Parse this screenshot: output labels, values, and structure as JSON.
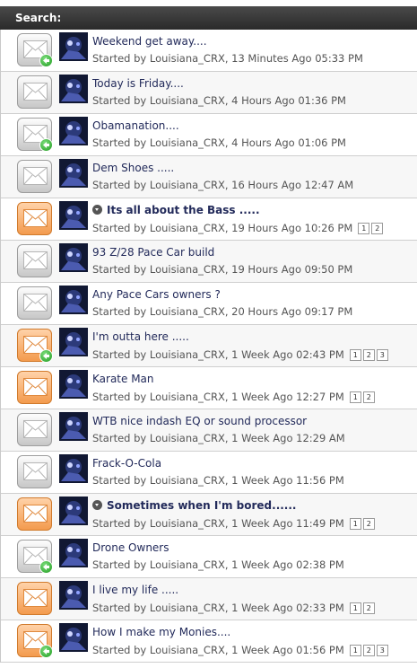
{
  "header": {
    "title": "Search:"
  },
  "threads": [
    {
      "title": "Weekend get away....",
      "meta": "Started by Louisiana_CRX, 13 Minutes Ago 05:33 PM",
      "icon": "gray",
      "new": true,
      "bold": false,
      "sticky": false,
      "pages": []
    },
    {
      "title": "Today is Friday....",
      "meta": "Started by Louisiana_CRX, 4 Hours Ago 01:36 PM",
      "icon": "gray",
      "new": false,
      "bold": false,
      "sticky": false,
      "pages": []
    },
    {
      "title": "Obamanation....",
      "meta": "Started by Louisiana_CRX, 4 Hours Ago 01:06 PM",
      "icon": "gray",
      "new": true,
      "bold": false,
      "sticky": false,
      "pages": []
    },
    {
      "title": "Dem Shoes .....",
      "meta": "Started by Louisiana_CRX, 16 Hours Ago 12:47 AM",
      "icon": "gray",
      "new": false,
      "bold": false,
      "sticky": false,
      "pages": []
    },
    {
      "title": "Its all about the Bass .....",
      "meta": "Started by Louisiana_CRX, 19 Hours Ago 10:26 PM",
      "icon": "orange",
      "new": false,
      "bold": true,
      "sticky": true,
      "pages": [
        "1",
        "2"
      ]
    },
    {
      "title": "93 Z/28 Pace Car build",
      "meta": "Started by Louisiana_CRX, 19 Hours Ago 09:50 PM",
      "icon": "gray",
      "new": false,
      "bold": false,
      "sticky": false,
      "pages": []
    },
    {
      "title": "Any Pace Cars owners ?",
      "meta": "Started by Louisiana_CRX, 20 Hours Ago 09:17 PM",
      "icon": "gray",
      "new": false,
      "bold": false,
      "sticky": false,
      "pages": []
    },
    {
      "title": "I'm outta here .....",
      "meta": "Started by Louisiana_CRX, 1 Week Ago 02:43 PM",
      "icon": "orange",
      "new": true,
      "bold": false,
      "sticky": false,
      "pages": [
        "1",
        "2",
        "3"
      ]
    },
    {
      "title": "Karate Man",
      "meta": "Started by Louisiana_CRX, 1 Week Ago 12:27 PM",
      "icon": "orange",
      "new": false,
      "bold": false,
      "sticky": false,
      "pages": [
        "1",
        "2"
      ]
    },
    {
      "title": "WTB nice indash EQ or sound processor",
      "meta": "Started by Louisiana_CRX, 1 Week Ago 12:29 AM",
      "icon": "gray",
      "new": false,
      "bold": false,
      "sticky": false,
      "pages": []
    },
    {
      "title": "Frack-O-Cola",
      "meta": "Started by Louisiana_CRX, 1 Week Ago 11:56 PM",
      "icon": "gray",
      "new": false,
      "bold": false,
      "sticky": false,
      "pages": []
    },
    {
      "title": "Sometimes when I'm bored......",
      "meta": "Started by Louisiana_CRX, 1 Week Ago 11:49 PM",
      "icon": "orange",
      "new": false,
      "bold": true,
      "sticky": true,
      "pages": [
        "1",
        "2"
      ]
    },
    {
      "title": "Drone Owners",
      "meta": "Started by Louisiana_CRX, 1 Week Ago 02:38 PM",
      "icon": "gray",
      "new": true,
      "bold": false,
      "sticky": false,
      "pages": []
    },
    {
      "title": "I live my life .....",
      "meta": "Started by Louisiana_CRX, 1 Week Ago 02:33 PM",
      "icon": "orange",
      "new": false,
      "bold": false,
      "sticky": false,
      "pages": [
        "1",
        "2"
      ]
    },
    {
      "title": "How I make my Monies....",
      "meta": "Started by Louisiana_CRX, 1 Week Ago 01:56 PM",
      "icon": "orange",
      "new": true,
      "bold": false,
      "sticky": false,
      "pages": [
        "1",
        "2",
        "3"
      ]
    }
  ]
}
